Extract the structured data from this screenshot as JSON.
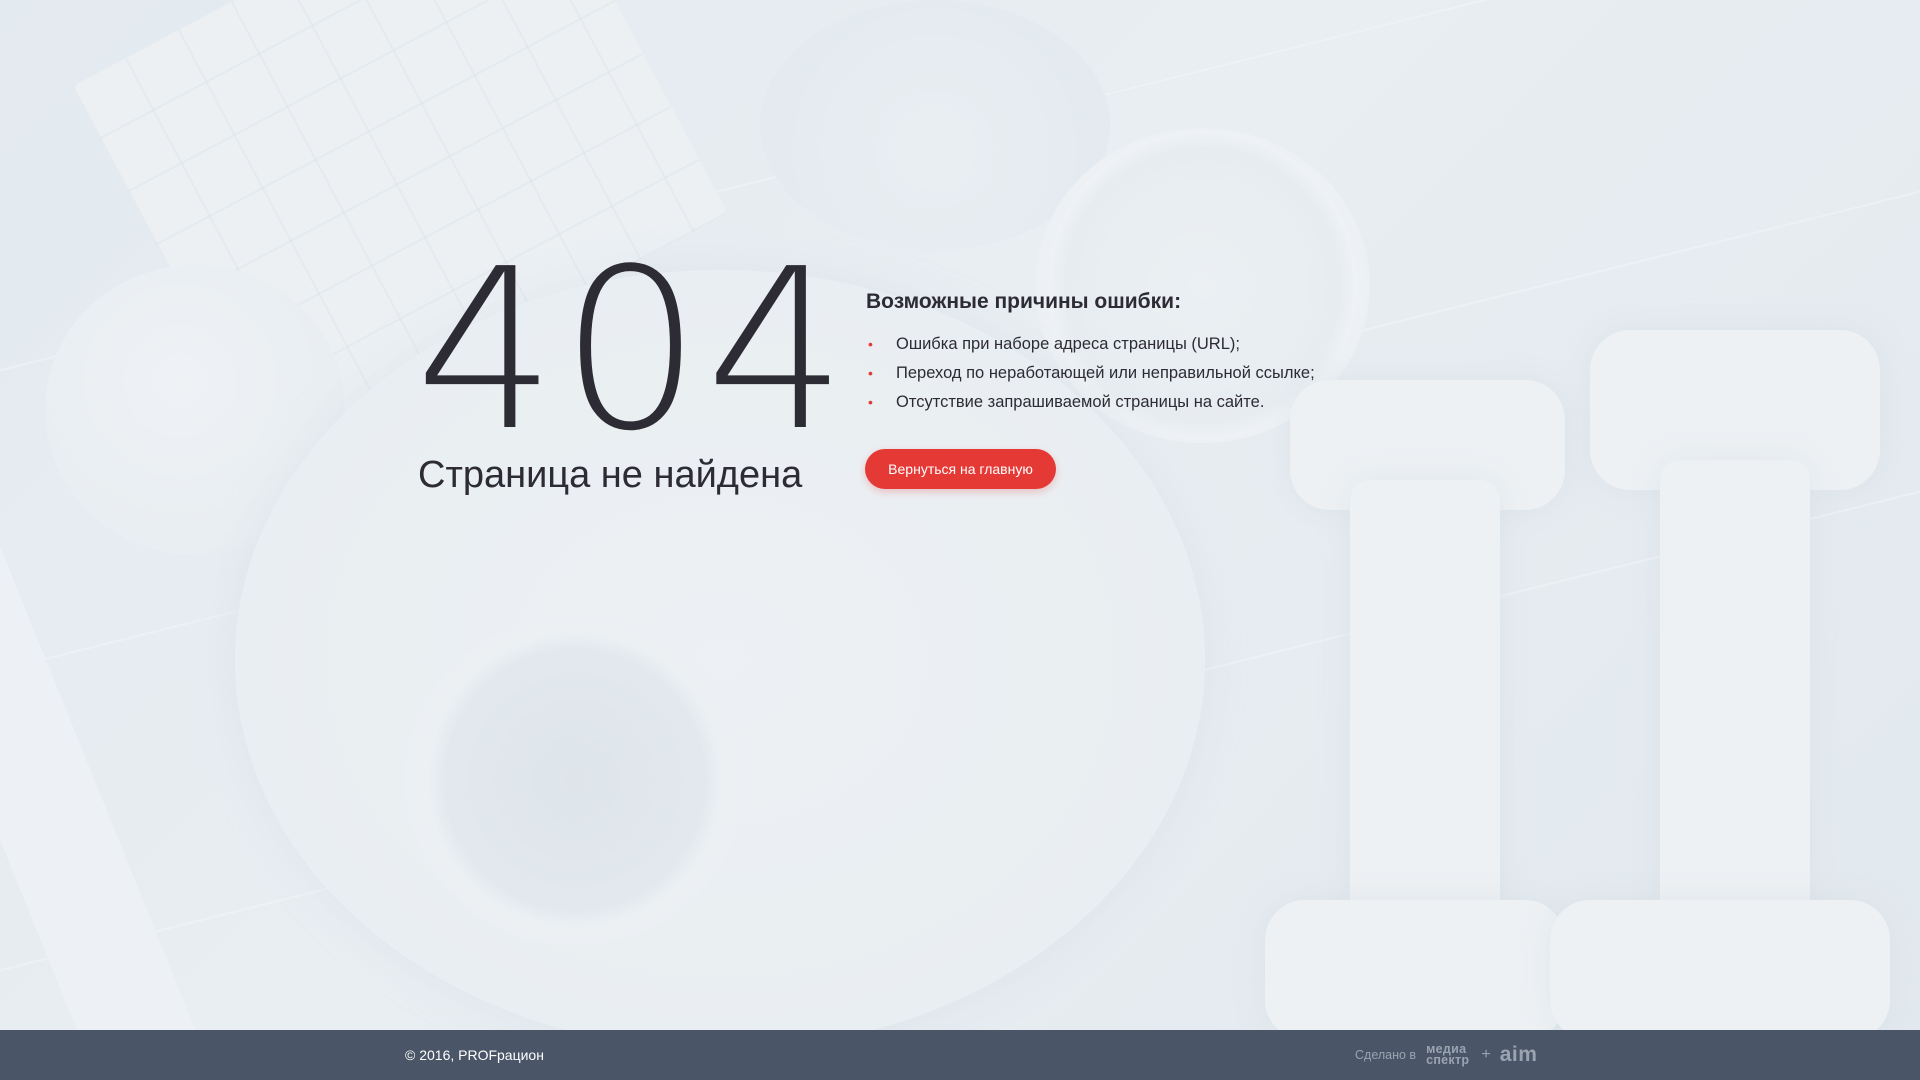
{
  "error": {
    "code": "404",
    "title": "Страница не найдена"
  },
  "reasons": {
    "heading": "Возможные причины ошибки:",
    "items": [
      "Ошибка при наборе адреса страницы (URL);",
      "Переход по неработающей или неправильной ссылке;",
      "Отсутствие запрашиваемой страницы на сайте."
    ]
  },
  "home_button": {
    "label": "Вернуться на главную"
  },
  "footer": {
    "copyright": "© 2016, PROFрацион",
    "made_label": "Сделано в",
    "studio_logo_line1": "медиа",
    "studio_logo_line2": "спектр",
    "plus": "+",
    "partner_logo": "aim"
  },
  "colors": {
    "accent": "#e53935",
    "footer_bg": "#4a5567",
    "text": "#2d2b33"
  }
}
